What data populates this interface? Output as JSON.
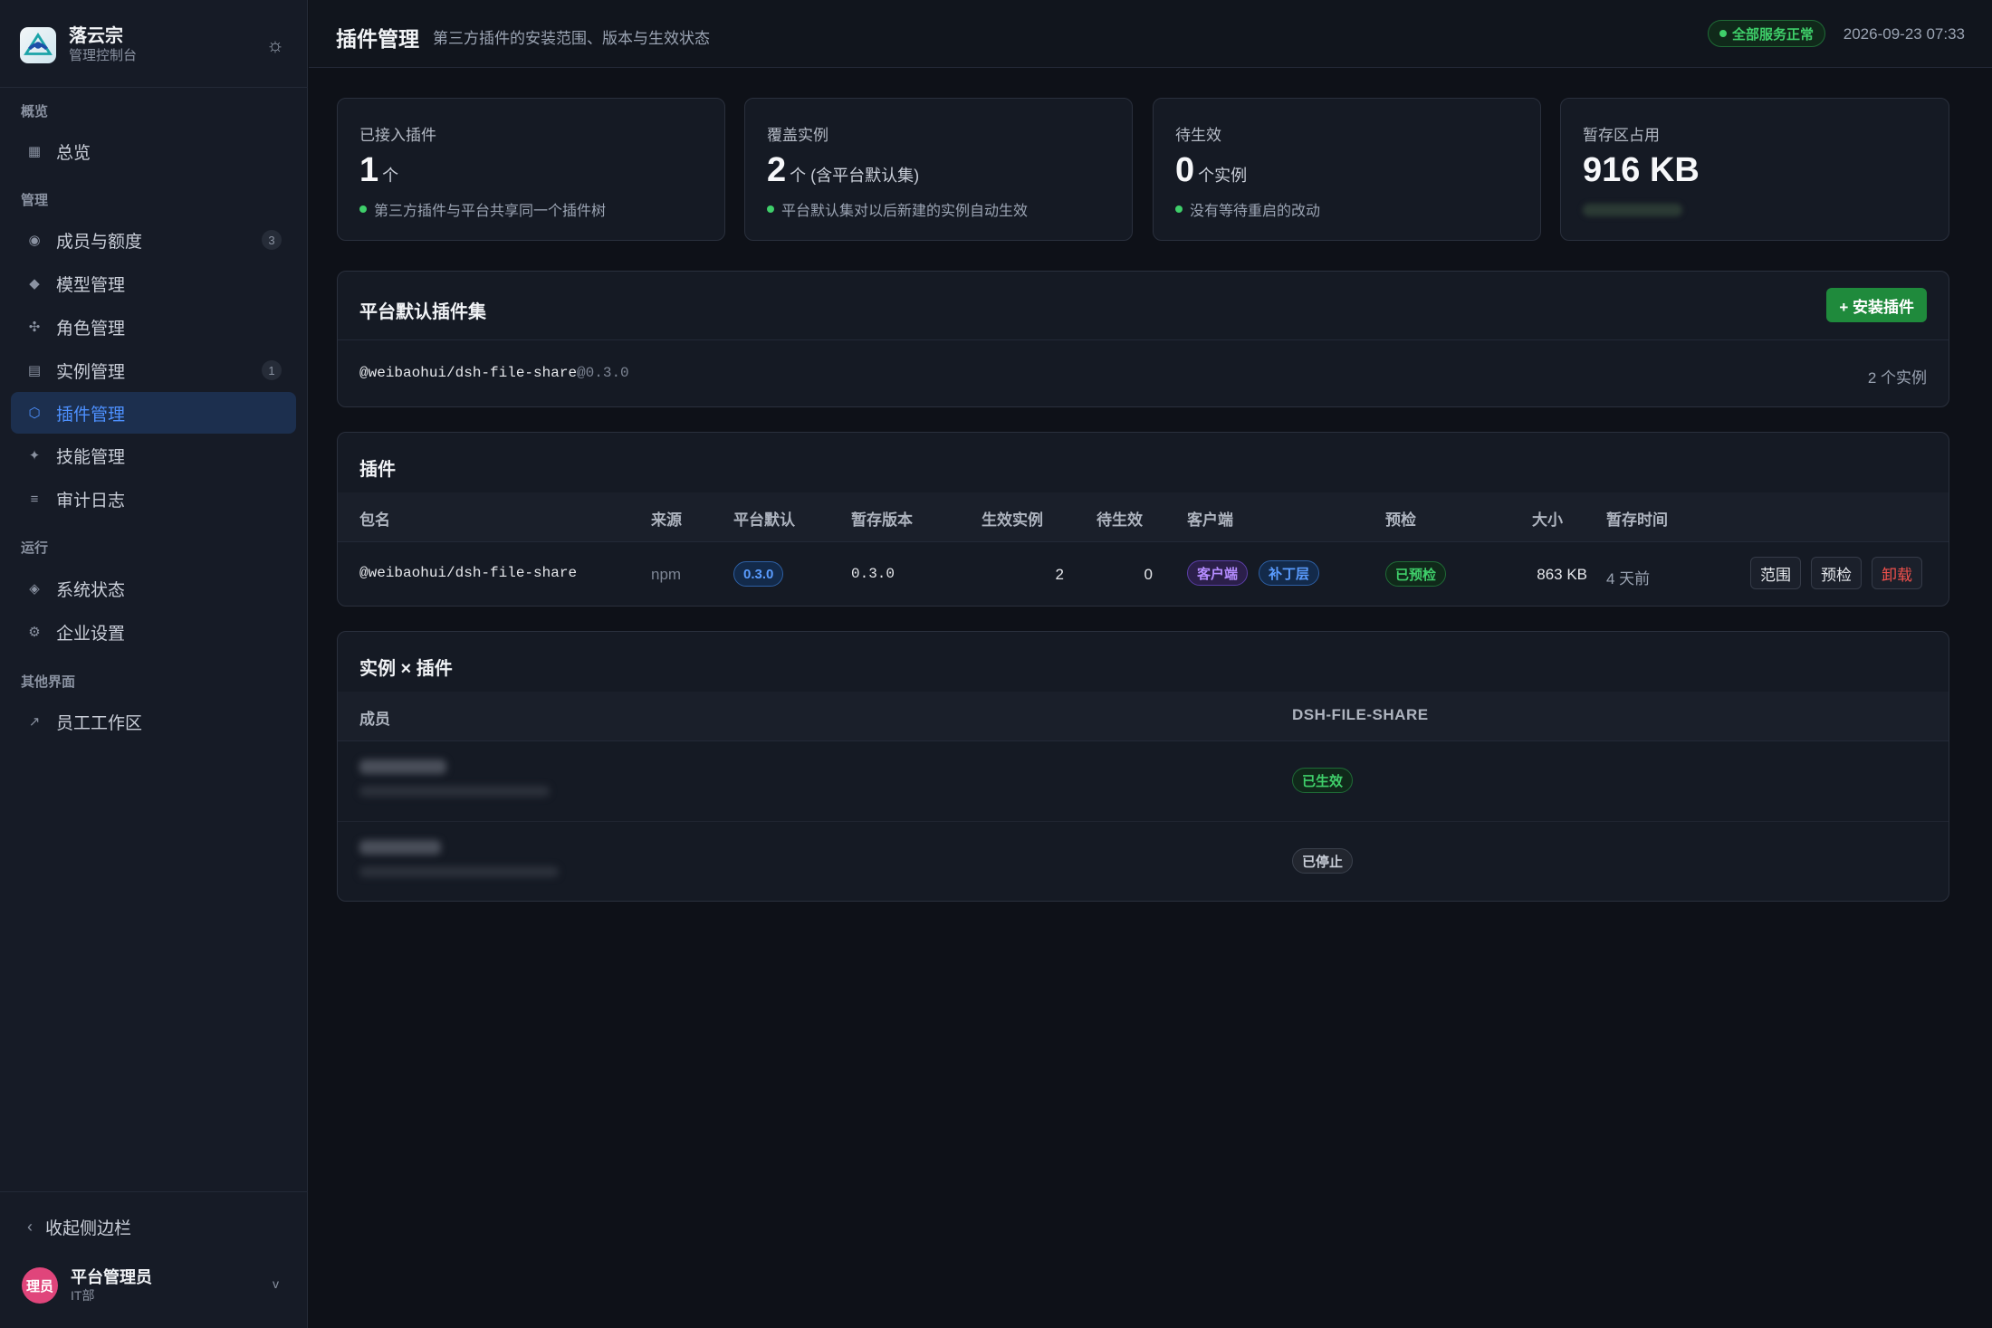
{
  "app": {
    "name": "落云宗",
    "subtitle": "管理控制台"
  },
  "nav": {
    "groups": {
      "overview": "概览",
      "manage": "管理",
      "run": "运行",
      "other": "其他界面"
    },
    "items": [
      {
        "label": "总览",
        "icon": "grid-icon"
      },
      {
        "label": "成员与额度",
        "icon": "member-icon",
        "badge": "3"
      },
      {
        "label": "模型管理",
        "icon": "model-icon"
      },
      {
        "label": "角色管理",
        "icon": "role-icon"
      },
      {
        "label": "实例管理",
        "icon": "instance-icon",
        "badge": "1"
      },
      {
        "label": "插件管理",
        "icon": "plugin-icon",
        "active": true
      },
      {
        "label": "技能管理",
        "icon": "skill-icon"
      },
      {
        "label": "审计日志",
        "icon": "log-icon"
      },
      {
        "label": "系统状态",
        "icon": "status-icon"
      },
      {
        "label": "企业设置",
        "icon": "settings-icon"
      },
      {
        "label": "员工工作区",
        "icon": "external-link-icon"
      }
    ],
    "collapse_label": "收起侧边栏"
  },
  "user": {
    "avatar": "理员",
    "name": "平台管理员",
    "dept": "IT部"
  },
  "header": {
    "title": "插件管理",
    "subtitle": "第三方插件的安装范围、版本与生效状态",
    "status": "全部服务正常",
    "datetime": "2026-09-23 07:33"
  },
  "stats": [
    {
      "label": "已接入插件",
      "value": "1",
      "unit": "个",
      "note": "第三方插件与平台共享同一个插件树"
    },
    {
      "label": "覆盖实例",
      "value": "2",
      "unit": "个 (含平台默认集)",
      "note": "平台默认集对以后新建的实例自动生效"
    },
    {
      "label": "待生效",
      "value": "0",
      "unit": "个实例",
      "note": "没有等待重启的改动"
    },
    {
      "label": "暂存区占用",
      "value": "916 KB",
      "unit": "",
      "note": ""
    }
  ],
  "default_set": {
    "title": "平台默认插件集",
    "install_button": "+ 安装插件",
    "package": "@weibaohui/dsh-file-share",
    "version_suffix": "@0.3.0",
    "instances": "2 个实例"
  },
  "plugins": {
    "title": "插件",
    "columns": [
      "包名",
      "来源",
      "平台默认",
      "暂存版本",
      "生效实例",
      "待生效",
      "客户端",
      "预检",
      "大小",
      "暂存时间"
    ],
    "rows": [
      {
        "package": "@weibaohui/dsh-file-share",
        "source": "npm",
        "platform_default": "0.3.0",
        "staged_version": "0.3.0",
        "active": "2",
        "pending": "0",
        "clients": [
          "客户端",
          "补丁层"
        ],
        "precheck": "已预检",
        "size": "863 KB",
        "staged_time": "4 天前",
        "actions": [
          "范围",
          "预检",
          "卸载"
        ]
      }
    ]
  },
  "matrix": {
    "title": "实例 × 插件",
    "columns": [
      "成员",
      "DSH-FILE-SHARE"
    ],
    "rows": [
      {
        "status": "已生效"
      },
      {
        "status": "已停止"
      }
    ]
  },
  "colors": {
    "accent": "#4d90fe",
    "success": "#3fcf6a",
    "danger": "#f0514c",
    "install": "#1f8a3c"
  }
}
